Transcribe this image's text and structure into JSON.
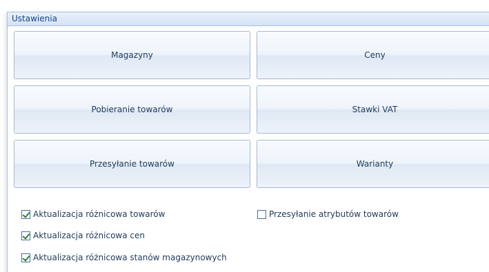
{
  "panel": {
    "title": "Ustawienia"
  },
  "tiles": [
    {
      "label": "Magazyny"
    },
    {
      "label": "Ceny"
    },
    {
      "label": "Pobieranie towarów"
    },
    {
      "label": "Stawki VAT"
    },
    {
      "label": "Przesyłanie towarów"
    },
    {
      "label": "Warianty"
    }
  ],
  "options": [
    {
      "label": "Aktualizacja różnicowa towarów",
      "checked": true
    },
    {
      "label": "Przesyłanie atrybutów towarów",
      "checked": false
    },
    {
      "label": "Aktualizacja różnicowa cen",
      "checked": true
    },
    {
      "label": "Aktualizacja różnicowa stanów magazynowych",
      "checked": true
    }
  ]
}
